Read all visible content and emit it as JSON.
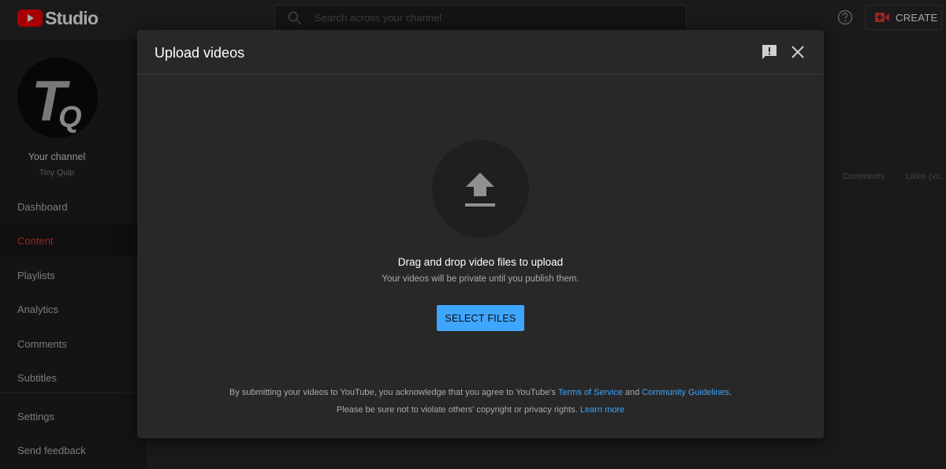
{
  "header": {
    "brand": "Studio",
    "search_placeholder": "Search across your channel",
    "create_label": "CREATE",
    "icons": {
      "search": "search-icon",
      "help": "help-icon",
      "create": "video-camera-icon"
    }
  },
  "sidebar": {
    "channel_title": "Your channel",
    "channel_name": "Tiny Quip",
    "items": [
      {
        "label": "Dashboard"
      },
      {
        "label": "Content",
        "active": true
      },
      {
        "label": "Playlists"
      },
      {
        "label": "Analytics"
      },
      {
        "label": "Comments"
      },
      {
        "label": "Subtitles"
      },
      {
        "label": "Settings"
      },
      {
        "label": "Send feedback"
      }
    ]
  },
  "background_table": {
    "columns": [
      "Comments",
      "Likes (vs."
    ]
  },
  "modal": {
    "title": "Upload videos",
    "drag_text": "Drag and drop video files to upload",
    "private_text": "Your videos will be private until you publish them.",
    "select_button": "SELECT FILES",
    "legal_prefix": "By submitting your videos to YouTube, you acknowledge that you agree to YouTube's ",
    "terms_link": "Terms of Service",
    "and_text": " and ",
    "guidelines_link": "Community Guidelines",
    "legal_end": ".",
    "copyright_text": "Please be sure not to violate others' copyright or privacy rights. ",
    "learn_more_link": "Learn more"
  },
  "colors": {
    "accent": "#3ea6ff",
    "active_nav": "#e53935",
    "brand_red": "#ff0000",
    "background": "#282828"
  }
}
